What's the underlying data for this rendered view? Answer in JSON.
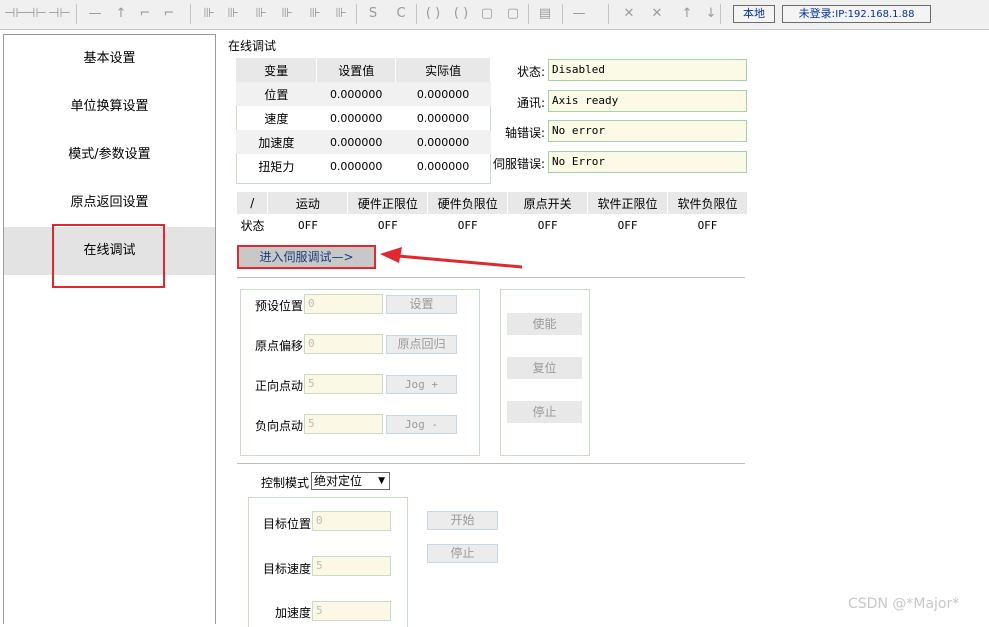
{
  "toolbar": {
    "icons": [
      "contact-icon",
      "contact-icon",
      "contact-icon",
      "line-icon",
      "arrow-up-icon",
      "step-icon",
      "step-icon",
      "coil-icon",
      "coil-icon",
      "coil-icon",
      "coil-icon",
      "coil-icon",
      "coil-icon",
      "set-icon",
      "reset-icon",
      "bracket-icon",
      "bracket-icon",
      "func-icon",
      "func-icon",
      "table-icon",
      "line-icon",
      "cross-icon",
      "cross-icon",
      "arrow-up-icon",
      "arrow-down-icon"
    ],
    "local_label": "本地",
    "login_label": "未登录:",
    "ip_label": "IP:192.168.1.88"
  },
  "sidebar": {
    "items": [
      {
        "label": "基本设置"
      },
      {
        "label": "单位换算设置"
      },
      {
        "label": "模式/参数设置"
      },
      {
        "label": "原点返回设置"
      },
      {
        "label": "在线调试"
      }
    ],
    "active_index": 4
  },
  "main": {
    "section_title": "在线调试",
    "vars_table": {
      "headers": [
        "变量",
        "设置值",
        "实际值"
      ],
      "rows": [
        {
          "name": "位置",
          "set": "0.000000",
          "actual": "0.000000"
        },
        {
          "name": "速度",
          "set": "0.000000",
          "actual": "0.000000"
        },
        {
          "name": "加速度",
          "set": "0.000000",
          "actual": "0.000000"
        },
        {
          "name": "扭矩力",
          "set": "0.000000",
          "actual": "0.000000"
        }
      ]
    },
    "status": {
      "state_label": "状态:",
      "state_value": "Disabled",
      "comm_label": "通讯:",
      "comm_value": "Axis ready",
      "axis_err_label": "轴错误:",
      "axis_err_value": "No error",
      "servo_err_label": "伺服错误:",
      "servo_err_value": "No Error"
    },
    "io_table": {
      "headers": [
        "/",
        "运动",
        "硬件正限位",
        "硬件负限位",
        "原点开关",
        "软件正限位",
        "软件负限位"
      ],
      "row_label": "状态",
      "values": [
        "OFF",
        "OFF",
        "OFF",
        "OFF",
        "OFF",
        "OFF"
      ]
    },
    "enter_servo_button": "进入伺服调试—>",
    "preset": {
      "preset_pos_label": "预设位置",
      "preset_pos_value": "0",
      "set_button": "设置",
      "origin_offset_label": "原点偏移",
      "origin_offset_value": "0",
      "home_button": "原点回归",
      "jog_pos_label": "正向点动",
      "jog_pos_value": "5",
      "jog_pos_button": "Jog +",
      "jog_neg_label": "负向点动",
      "jog_neg_value": "5",
      "jog_neg_button": "Jog -"
    },
    "power": {
      "enable_button": "使能",
      "reset_button": "复位",
      "stop_button": "停止"
    },
    "control": {
      "mode_label": "控制模式",
      "mode_value": "绝对定位",
      "target_pos_label": "目标位置",
      "target_pos_value": "0",
      "target_speed_label": "目标速度",
      "target_speed_value": "5",
      "accel_label": "加速度",
      "accel_value": "5",
      "start_button": "开始",
      "stop_button": "停止"
    }
  },
  "watermark": "CSDN @*Major*",
  "colors": {
    "highlight_red": "#e0282e",
    "field_bg": "#fbf8e6",
    "status_bg": "#fafae6"
  }
}
